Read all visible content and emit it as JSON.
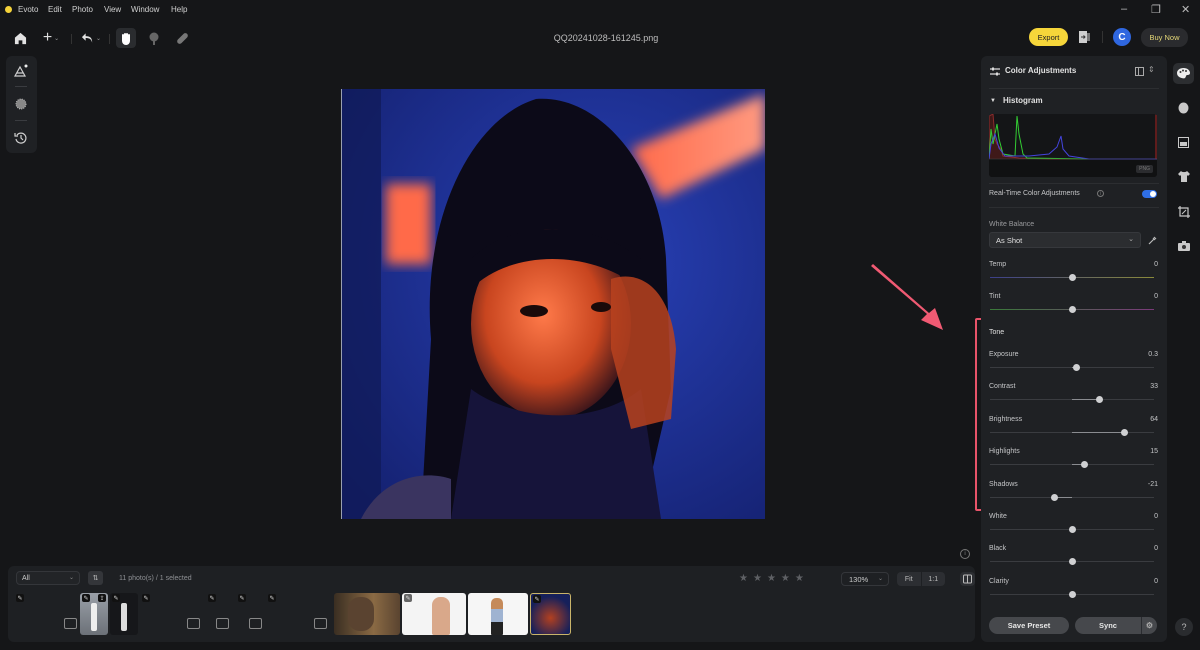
{
  "app": {
    "name": "Evoto",
    "menu": [
      "Edit",
      "Photo",
      "View",
      "Window",
      "Help"
    ],
    "window_controls": {
      "minimize": "–",
      "maximize": "❐",
      "close": "✕"
    }
  },
  "toolbar": {
    "filename": "QQ20241028-161245.png",
    "export_label": "Export",
    "avatar_initial": "C",
    "buy_now_label": "Buy Now",
    "tools": [
      "home-icon",
      "add-icon",
      "undo-icon",
      "hand-icon",
      "tree-icon",
      "bandage-icon"
    ],
    "active_tool": "hand-icon"
  },
  "left_tools": [
    "ai-enhance-icon",
    "dust-icon",
    "history-icon"
  ],
  "filmstrip": {
    "filter_value": "All",
    "sort_label": "⇅",
    "count_text": "11 photo(s) / 1 selected",
    "rating_stars": 5,
    "zoom_value": "130%",
    "fit_label": "Fit",
    "one_to_one_label": "1:1",
    "thumbnails": [
      {
        "kind": "missing",
        "edited": true
      },
      {
        "kind": "photo-white-suit-grey",
        "edited": true,
        "exported": true
      },
      {
        "kind": "photo-white-suit-dark",
        "edited": true
      },
      {
        "kind": "missing",
        "edited": true
      },
      {
        "kind": "missing",
        "edited": true
      },
      {
        "kind": "missing",
        "edited": true
      },
      {
        "kind": "missing",
        "edited": true
      },
      {
        "kind": "photo-man-warm",
        "edited": false
      },
      {
        "kind": "photo-woman-white",
        "edited": true
      },
      {
        "kind": "photo-woman-blue-top",
        "edited": false
      },
      {
        "kind": "photo-woman-red-blue",
        "edited": true,
        "selected": true
      }
    ]
  },
  "panel": {
    "title": "Color Adjustments",
    "histogram": {
      "title": "Histogram",
      "format_tag": "PNG"
    },
    "realtime": {
      "label": "Real-Time Color Adjustments",
      "enabled": true
    },
    "white_balance": {
      "label": "White Balance",
      "value": "As Shot"
    },
    "sliders_wb": [
      {
        "label": "Temp",
        "value": "0",
        "pos": 0.5
      },
      {
        "label": "Tint",
        "value": "0",
        "pos": 0.5
      }
    ],
    "tone": {
      "title": "Tone",
      "sliders": [
        {
          "label": "Exposure",
          "value": "0.3",
          "pos": 0.53
        },
        {
          "label": "Contrast",
          "value": "33",
          "pos": 0.665
        },
        {
          "label": "Brightness",
          "value": "64",
          "pos": 0.82
        },
        {
          "label": "Highlights",
          "value": "15",
          "pos": 0.575
        },
        {
          "label": "Shadows",
          "value": "-21",
          "pos": 0.395
        }
      ]
    },
    "sliders_more": [
      {
        "label": "White",
        "value": "0",
        "pos": 0.5
      },
      {
        "label": "Black",
        "value": "0",
        "pos": 0.5
      },
      {
        "label": "Clarity",
        "value": "0",
        "pos": 0.5
      }
    ],
    "save_preset_label": "Save Preset",
    "sync_label": "Sync"
  },
  "right_rail": [
    "palette-icon",
    "face-icon",
    "background-icon",
    "clothing-icon",
    "crop-icon",
    "camera-icon"
  ],
  "help_label": "?",
  "colors": {
    "accent": "#f6d63a",
    "toggle": "#2f6fe6",
    "annotation": "#e8546a"
  }
}
